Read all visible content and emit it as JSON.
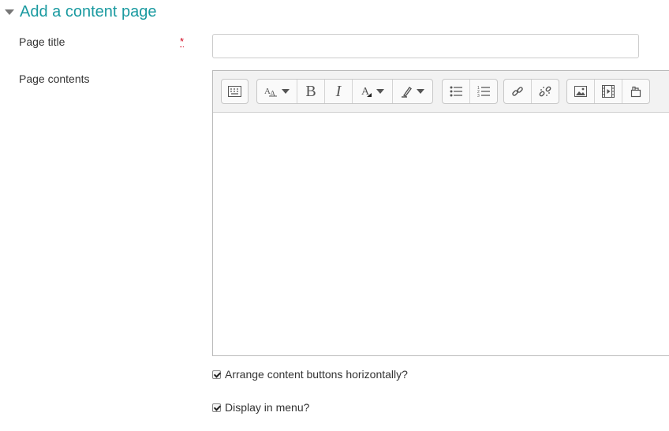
{
  "section": {
    "title": "Add a content page",
    "collapse_icon": "chevron-down-icon"
  },
  "page_title": {
    "label": "Page title",
    "required_symbol": "*",
    "value": "",
    "placeholder": ""
  },
  "page_contents": {
    "label": "Page contents",
    "toolbar_icons": [
      [
        "toolbar-toggle-icon"
      ],
      [
        "font-size-icon",
        "bold-icon",
        "italic-icon",
        "font-color-icon",
        "background-color-icon"
      ],
      [
        "bulleted-list-icon",
        "numbered-list-icon"
      ],
      [
        "link-icon",
        "unlink-icon"
      ],
      [
        "image-icon",
        "media-icon",
        "manage-files-icon"
      ]
    ],
    "bold_glyph": "B",
    "italic_glyph": "I"
  },
  "options": [
    {
      "label": "Arrange content buttons horizontally?",
      "checked": true
    },
    {
      "label": "Display in menu?",
      "checked": true
    }
  ],
  "colors": {
    "accent": "#1a9aa0",
    "required": "#d0021b"
  }
}
